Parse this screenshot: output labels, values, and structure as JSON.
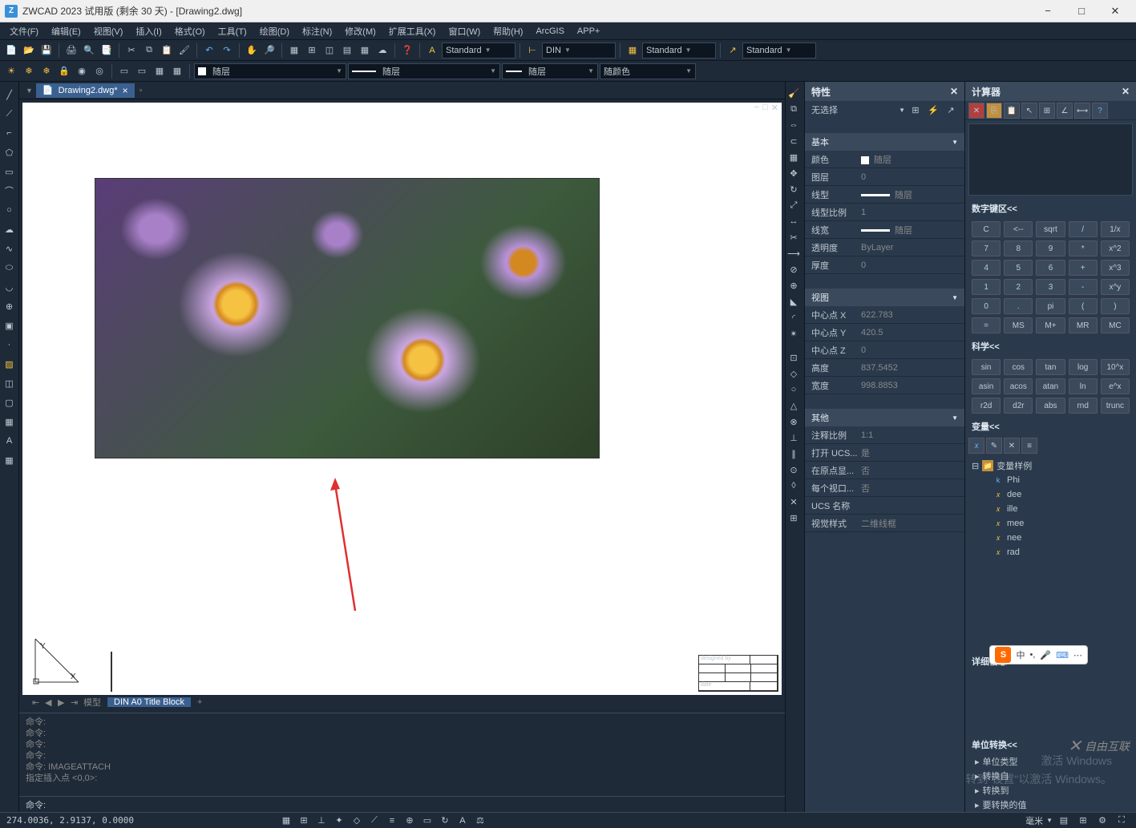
{
  "window": {
    "title": "ZWCAD 2023 试用版 (剩余 30 天) - [Drawing2.dwg]"
  },
  "menus": [
    "文件(F)",
    "编辑(E)",
    "视图(V)",
    "插入(I)",
    "格式(O)",
    "工具(T)",
    "绘图(D)",
    "标注(N)",
    "修改(M)",
    "扩展工具(X)",
    "窗口(W)",
    "帮助(H)",
    "ArcGIS",
    "APP+"
  ],
  "toolbar_combos": {
    "standard1": "Standard",
    "din": "DIN",
    "standard2": "Standard",
    "standard3": "Standard",
    "layer": "随层",
    "ltype": "随层",
    "lweight": "随层",
    "color": "随颜色"
  },
  "tab": {
    "name": "Drawing2.dwg*"
  },
  "model_tabs": {
    "model": "模型",
    "layout": "DIN A0 Title Block"
  },
  "props": {
    "title": "特性",
    "selection": "无选择",
    "sections": {
      "basic": {
        "hdr": "基本",
        "rows": [
          {
            "k": "颜色",
            "v": "随层",
            "sw": true
          },
          {
            "k": "图层",
            "v": "0"
          },
          {
            "k": "线型",
            "v": "随层",
            "line": true
          },
          {
            "k": "线型比例",
            "v": "1"
          },
          {
            "k": "线宽",
            "v": "随层",
            "line": true
          },
          {
            "k": "透明度",
            "v": "ByLayer"
          },
          {
            "k": "厚度",
            "v": "0"
          }
        ]
      },
      "view": {
        "hdr": "视图",
        "rows": [
          {
            "k": "中心点 X",
            "v": "622.783"
          },
          {
            "k": "中心点 Y",
            "v": "420.5"
          },
          {
            "k": "中心点 Z",
            "v": "0"
          },
          {
            "k": "高度",
            "v": "837.5452"
          },
          {
            "k": "宽度",
            "v": "998.8853"
          }
        ]
      },
      "other": {
        "hdr": "其他",
        "rows": [
          {
            "k": "注释比例",
            "v": "1:1"
          },
          {
            "k": "打开 UCS...",
            "v": "是"
          },
          {
            "k": "在原点显...",
            "v": "否"
          },
          {
            "k": "每个视口...",
            "v": "否"
          },
          {
            "k": "UCS 名称",
            "v": ""
          },
          {
            "k": "视觉样式",
            "v": "二维线框"
          }
        ]
      }
    }
  },
  "calc": {
    "title": "计算器",
    "sections": {
      "numpad": "数字键区<<",
      "sci": "科学<<",
      "vars": "变量<<",
      "detail": "详细信息",
      "unit": "单位转换<<"
    },
    "numpad": [
      [
        "C",
        "<--",
        "sqrt",
        "/",
        "1/x"
      ],
      [
        "7",
        "8",
        "9",
        "*",
        "x^2"
      ],
      [
        "4",
        "5",
        "6",
        "+",
        "x^3"
      ],
      [
        "1",
        "2",
        "3",
        "-",
        "x^y"
      ],
      [
        "0",
        ".",
        "pi",
        "(",
        ")"
      ],
      [
        "=",
        "MS",
        "M+",
        "MR",
        "MC"
      ]
    ],
    "sci": [
      [
        "sin",
        "cos",
        "tan",
        "log",
        "10^x"
      ],
      [
        "asin",
        "acos",
        "atan",
        "ln",
        "e^x"
      ],
      [
        "r2d",
        "d2r",
        "abs",
        "rnd",
        "trunc"
      ]
    ],
    "var_root": "变量样例",
    "vars_list": [
      "Phi",
      "dee",
      "ille",
      "mee",
      "nee",
      "rad"
    ],
    "unit_rows": [
      "单位类型",
      "转换自",
      "转换到",
      "要转换的值"
    ]
  },
  "command": {
    "lines": [
      "命令:",
      "命令:",
      "命令:",
      "命令:",
      "命令: IMAGEATTACH",
      "指定插入点 <0,0>:"
    ],
    "prompt": "命令:"
  },
  "status": {
    "coords": "274.0036, 2.9137, 0.0000",
    "unit": "毫米"
  },
  "titleblock": {
    "designed": "designed by",
    "date": "date"
  },
  "watermark": {
    "l1": "激活 Windows",
    "l2": "转到\"设置\"以激活 Windows。",
    "logo": "自由互联",
    "ime": "中"
  }
}
